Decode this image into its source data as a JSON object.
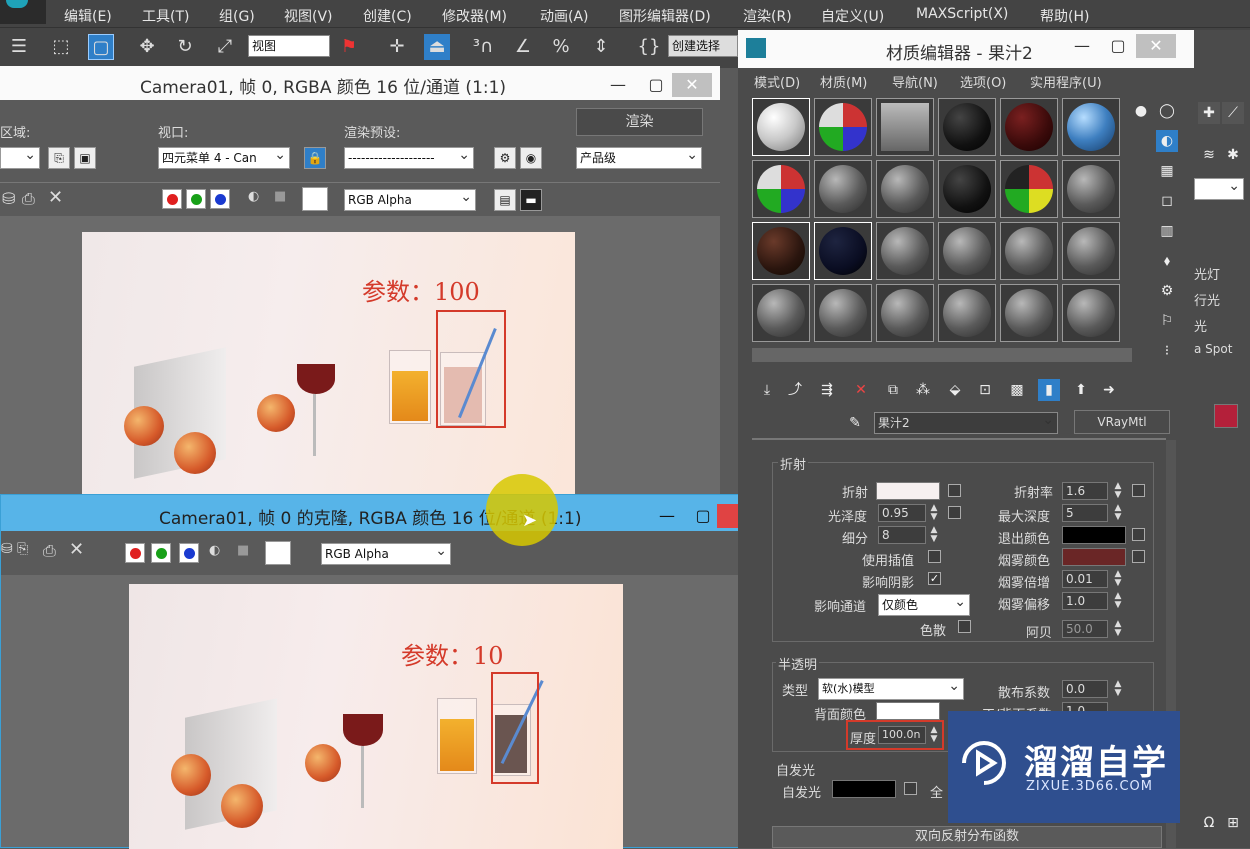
{
  "menubar": {
    "items": [
      "编辑(E)",
      "工具(T)",
      "组(G)",
      "视图(V)",
      "创建(C)",
      "修改器(M)",
      "动画(A)",
      "图形编辑器(D)",
      "渲染(R)",
      "自定义(U)",
      "MAXScript(X)",
      "帮助(H)"
    ]
  },
  "toolbar": {
    "viewport_select": "视图",
    "create_select": "创建选择"
  },
  "render_window_1": {
    "title": "Camera01, 帧 0, RGBA 颜色 16 位/通道 (1:1)",
    "area_label": "区域:",
    "viewport_label": "视口:",
    "viewport_value": "四元菜单 4 - Can",
    "preset_label": "渲染预设:",
    "preset_value": "--------------------",
    "render_button": "渲染",
    "quality_value": "产品级",
    "channel_value": "RGB Alpha",
    "annotation": "参数：100"
  },
  "render_window_2": {
    "title": "Camera01, 帧 0 的克隆, RGBA 颜色 16 位/通道 (1:1)",
    "channel_value": "RGB Alpha",
    "annotation": "参数：10"
  },
  "material_editor": {
    "title": "材质编辑器 - 果汁2",
    "menu": [
      "模式(D)",
      "材质(M)",
      "导航(N)",
      "选项(O)",
      "实用程序(U)"
    ],
    "material_name": "果汁2",
    "material_type": "VRayMtl",
    "refraction": {
      "group_label": "折射",
      "refract_label": "折射",
      "glossiness_label": "光泽度",
      "glossiness_value": "0.95",
      "subdivs_label": "细分",
      "subdivs_value": "8",
      "use_interp_label": "使用插值",
      "affect_shadows_label": "影响阴影",
      "affect_channels_label": "影响通道",
      "affect_channels_value": "仅颜色",
      "dispersion_label": "色散",
      "ior_label": "折射率",
      "ior_value": "1.6",
      "max_depth_label": "最大深度",
      "max_depth_value": "5",
      "exit_color_label": "退出颜色",
      "fog_color_label": "烟雾颜色",
      "fog_mult_label": "烟雾倍增",
      "fog_mult_value": "0.01",
      "fog_bias_label": "烟雾偏移",
      "fog_bias_value": "1.0",
      "abbe_label": "阿贝",
      "abbe_value": "50.0"
    },
    "translucency": {
      "group_label": "半透明",
      "type_label": "类型",
      "type_value": "软(水)模型",
      "back_color_label": "背面颜色",
      "thickness_label": "厚度",
      "thickness_value": "100.0n",
      "scatter_label": "散布系数",
      "scatter_value": "0.0",
      "fwd_label": "正/背面系数",
      "fwd_value": "1.0"
    },
    "self_illum": {
      "group_label": "自发光",
      "label": "自发光",
      "gi_label": "全"
    },
    "brdf_label": "双向反射分布函数"
  },
  "right_strip": {
    "items": [
      "光灯",
      "行光",
      "光",
      "a Spot"
    ]
  },
  "watermark": {
    "name": "溜溜自学",
    "url": "ZIXUE.3D66.COM"
  },
  "colors": {
    "annotation_red": "#d43a2a",
    "fog_color": "#6a2626",
    "watermark_bg": "#2f4f8f"
  }
}
